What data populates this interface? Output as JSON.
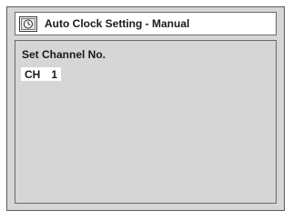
{
  "window": {
    "title": "Auto Clock Setting - Manual",
    "icon": "clock-icon"
  },
  "content": {
    "section_label": "Set Channel No.",
    "channel": {
      "prefix": "CH",
      "value": "1"
    }
  },
  "colors": {
    "screen_background": "#d6d6d6",
    "field_background": "#ffffff",
    "border": "#6a6a6a",
    "text": "#1a1a1a"
  }
}
